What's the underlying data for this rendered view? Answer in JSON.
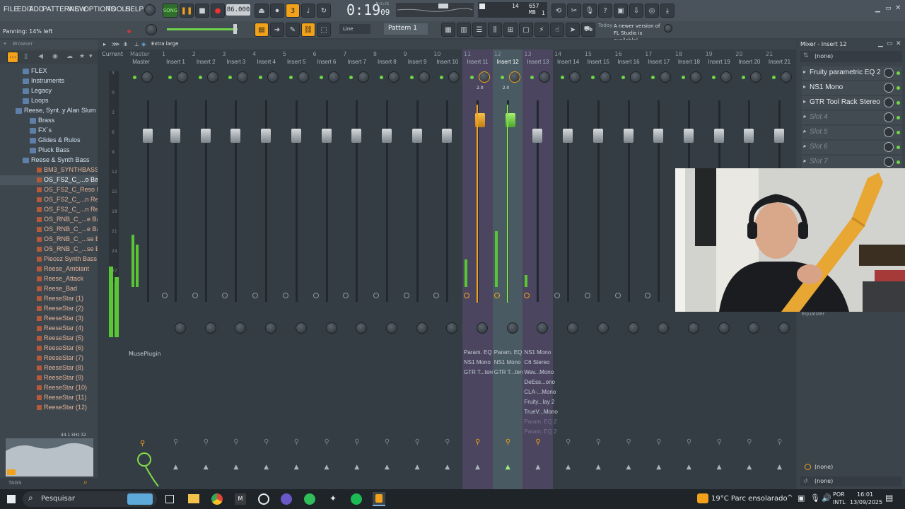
{
  "menubar": {
    "items": [
      "FILE",
      "EDIT",
      "ADD",
      "PATTERNS",
      "VIEW",
      "OPTIONS",
      "TOOLS",
      "HELP"
    ],
    "song_label": "SONG",
    "tempo": "86.000",
    "time": "0:19",
    "time_sub": "09",
    "msc": "M:S:CS",
    "cpu": "14",
    "ram": "657 MB",
    "ram_sub": "1",
    "hint": "Panning: 14% left"
  },
  "toolbar2": {
    "snap": "Line",
    "pattern": "Pattern 1",
    "news_day": "Today",
    "news_text": "A newer version of FL Studio is available!"
  },
  "browser": {
    "title": "Browser",
    "size_mode": "Extra large",
    "tags": "TAGS",
    "sample_info": "44.1 kHz 32",
    "items": [
      {
        "label": "FLEX",
        "kind": "folder",
        "indent": 1
      },
      {
        "label": "Instruments",
        "kind": "folder",
        "indent": 1
      },
      {
        "label": "Legacy",
        "kind": "folder",
        "indent": 1
      },
      {
        "label": "Loops",
        "kind": "folder",
        "indent": 1
      },
      {
        "label": "Reese, Synt..y Alan Slum",
        "kind": "folder",
        "indent": 0
      },
      {
        "label": "Brass",
        "kind": "folder",
        "indent": 2
      },
      {
        "label": "FX´s",
        "kind": "folder",
        "indent": 2
      },
      {
        "label": "Glides & Rulos",
        "kind": "folder",
        "indent": 2
      },
      {
        "label": "Pluck Bass",
        "kind": "folder",
        "indent": 2
      },
      {
        "label": "Reese & Synth Bass",
        "kind": "folder",
        "indent": 1
      },
      {
        "label": "BM3_SYNTHBASS",
        "kind": "file",
        "indent": 3
      },
      {
        "label": "OS_FS2_C_...o Bass 1",
        "kind": "file",
        "indent": 3,
        "selected": true
      },
      {
        "label": "OS_FS2_C_Reso Bass 2",
        "kind": "file",
        "indent": 3
      },
      {
        "label": "OS_FS2_C_...n Reese 1",
        "kind": "file",
        "indent": 3
      },
      {
        "label": "OS_FS2_C_...n Reese 2",
        "kind": "file",
        "indent": 3
      },
      {
        "label": "OS_RNB_C_...e Bass 1",
        "kind": "file",
        "indent": 3
      },
      {
        "label": "OS_RNB_C_...e Bass 2",
        "kind": "file",
        "indent": 3
      },
      {
        "label": "OS_RNB_C_...se Bass 1",
        "kind": "file",
        "indent": 3
      },
      {
        "label": "OS_RNB_C_...se Bass 2",
        "kind": "file",
        "indent": 3
      },
      {
        "label": "Piecez Synth Bass",
        "kind": "file",
        "indent": 3
      },
      {
        "label": "Reese_Ambiant",
        "kind": "file",
        "indent": 3
      },
      {
        "label": "Reese_Attack",
        "kind": "file",
        "indent": 3
      },
      {
        "label": "Reese_Bad",
        "kind": "file",
        "indent": 3
      },
      {
        "label": "ReeseStar  (1)",
        "kind": "file",
        "indent": 3
      },
      {
        "label": "ReeseStar  (2)",
        "kind": "file",
        "indent": 3
      },
      {
        "label": "ReeseStar  (3)",
        "kind": "file",
        "indent": 3
      },
      {
        "label": "ReeseStar  (4)",
        "kind": "file",
        "indent": 3
      },
      {
        "label": "ReeseStar  (5)",
        "kind": "file",
        "indent": 3
      },
      {
        "label": "ReeseStar  (6)",
        "kind": "file",
        "indent": 3
      },
      {
        "label": "ReeseStar  (7)",
        "kind": "file",
        "indent": 3
      },
      {
        "label": "ReeseStar  (8)",
        "kind": "file",
        "indent": 3
      },
      {
        "label": "ReeseStar  (9)",
        "kind": "file",
        "indent": 3
      },
      {
        "label": "ReeseStar  (10)",
        "kind": "file",
        "indent": 3
      },
      {
        "label": "ReeseStar  (11)",
        "kind": "file",
        "indent": 3
      },
      {
        "label": "ReeseStar  (12)",
        "kind": "file",
        "indent": 3
      }
    ]
  },
  "mixer": {
    "current_label": "Current",
    "master_label": "Master",
    "master_plugin": "MusePlugin",
    "db_marks": [
      "3",
      "0",
      "3",
      "6",
      "9",
      "12",
      "15",
      "18",
      "21",
      "24",
      "27"
    ],
    "strips": [
      {
        "n": "1",
        "label": "Insert 1"
      },
      {
        "n": "2",
        "label": "Insert 2"
      },
      {
        "n": "3",
        "label": "Insert 3"
      },
      {
        "n": "4",
        "label": "Insert 4"
      },
      {
        "n": "5",
        "label": "Insert 5"
      },
      {
        "n": "6",
        "label": "Insert 6"
      },
      {
        "n": "7",
        "label": "Insert 7"
      },
      {
        "n": "8",
        "label": "Insert 8"
      },
      {
        "n": "9",
        "label": "Insert 9"
      },
      {
        "n": "10",
        "label": "Insert 10"
      },
      {
        "n": "11",
        "label": "Insert 11",
        "active": true,
        "plugins": [
          "Param. EQ 2",
          "NS1 Mono",
          "GTR T...tereo"
        ],
        "level": 0.35,
        "pan_readout": "2.0"
      },
      {
        "n": "12",
        "label": "Insert 12",
        "selected": true,
        "plugins": [
          "Param. EQ 2",
          "NS1 Mono",
          "GTR T...tereo"
        ],
        "level": 0.72,
        "pan_readout": "2.0"
      },
      {
        "n": "13",
        "label": "Insert 13",
        "active": true,
        "plugins": [
          "NS1 Mono",
          "C6 Stereo",
          "Wav...Mono",
          "DeEss...ono",
          "CLA-...Mono",
          "Fruity...lay 2",
          "TrueV...Mono",
          "Param. EQ 2",
          "Param. EQ 2"
        ],
        "level": 0.15
      },
      {
        "n": "14",
        "label": "Insert 14"
      },
      {
        "n": "15",
        "label": "Insert 15"
      },
      {
        "n": "16",
        "label": "Insert 16"
      },
      {
        "n": "17",
        "label": "Insert 17"
      },
      {
        "n": "18",
        "label": "Insert 18"
      },
      {
        "n": "19",
        "label": "Insert 19"
      },
      {
        "n": "20",
        "label": "Insert 20"
      },
      {
        "n": "21",
        "label": "Insert 21"
      }
    ]
  },
  "rightpanel": {
    "title": "Mixer - Insert 12",
    "input": "(none)",
    "output": "(none)",
    "output2": "(none)",
    "slots": [
      {
        "label": "Fruity parametric EQ 2",
        "used": true
      },
      {
        "label": "NS1 Mono",
        "used": true
      },
      {
        "label": "GTR Tool Rack Stereo",
        "used": true
      },
      {
        "label": "Slot 4",
        "used": false
      },
      {
        "label": "Slot 5",
        "used": false
      },
      {
        "label": "Slot 6",
        "used": false
      },
      {
        "label": "Slot 7",
        "used": false
      }
    ],
    "eq_label": "Equalizer"
  },
  "taskbar": {
    "search": "Pesquisar",
    "weather": "19°C  Parc ensolarado",
    "lang1": "POR",
    "lang2": "INTL",
    "time": "16:01",
    "date": "13/09/2025"
  },
  "colors": {
    "accent": "#f2a21a",
    "meter": "#59c634",
    "selected": "#4a5a63",
    "purple": "#4b4560"
  }
}
